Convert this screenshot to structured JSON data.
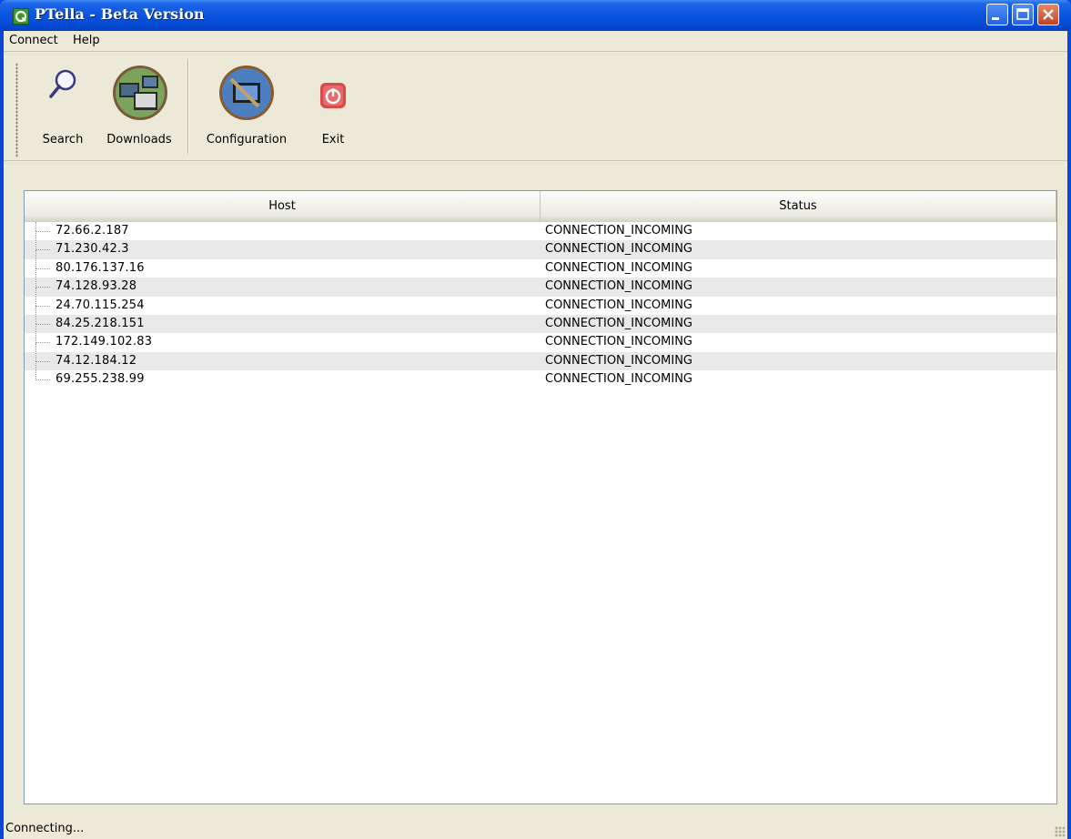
{
  "window": {
    "title": "PTella - Beta Version",
    "app_icon": "ptella-q-icon",
    "controls": [
      "minimize-icon",
      "maximize-icon",
      "close-icon"
    ]
  },
  "menu": {
    "items": [
      {
        "label": "Connect"
      },
      {
        "label": "Help"
      }
    ]
  },
  "toolbar": {
    "buttons": [
      {
        "label": "Search",
        "icon": "magnifier-icon"
      },
      {
        "label": "Downloads",
        "icon": "downloads-computers-icon"
      },
      {
        "label": "Configuration",
        "icon": "configuration-computer-icon"
      },
      {
        "label": "Exit",
        "icon": "power-exit-icon"
      }
    ]
  },
  "table": {
    "columns": [
      "Host",
      "Status"
    ],
    "rows": [
      {
        "host": "72.66.2.187",
        "status": "CONNECTION_INCOMING"
      },
      {
        "host": "71.230.42.3",
        "status": "CONNECTION_INCOMING"
      },
      {
        "host": "80.176.137.16",
        "status": "CONNECTION_INCOMING"
      },
      {
        "host": "74.128.93.28",
        "status": "CONNECTION_INCOMING"
      },
      {
        "host": "24.70.115.254",
        "status": "CONNECTION_INCOMING"
      },
      {
        "host": "84.25.218.151",
        "status": "CONNECTION_INCOMING"
      },
      {
        "host": "172.149.102.83",
        "status": "CONNECTION_INCOMING"
      },
      {
        "host": "74.12.184.12",
        "status": "CONNECTION_INCOMING"
      },
      {
        "host": "69.255.238.99",
        "status": "CONNECTION_INCOMING"
      }
    ]
  },
  "statusbar": {
    "text": "Connecting..."
  },
  "colors": {
    "titlebar": "#0a55de",
    "window_bg": "#ece9d8",
    "row_alt": "#e9e9e9",
    "close_button": "#c2421f"
  }
}
